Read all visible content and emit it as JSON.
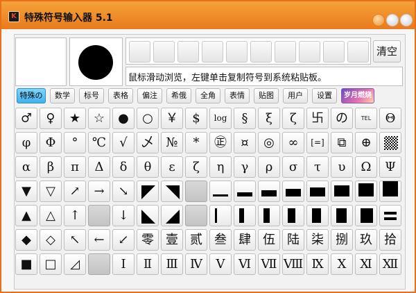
{
  "window": {
    "title": "特殊符号输入器 5.1",
    "icon": "app-logo-icon",
    "accent": "#e97b1d"
  },
  "preview": {
    "selected_symbol": "●"
  },
  "recent_slots": 10,
  "clear_label": "清空",
  "hint": "鼠标滑动浏览，左键单击复制符号到系统粘贴板。",
  "tabs": [
    {
      "label": "特殊の",
      "active": true
    },
    {
      "label": "数学"
    },
    {
      "label": "标号"
    },
    {
      "label": "表格"
    },
    {
      "label": "偏注"
    },
    {
      "label": "希俄"
    },
    {
      "label": "全角"
    },
    {
      "label": "表情"
    },
    {
      "label": "贴图"
    },
    {
      "label": "用户"
    },
    {
      "label": "设置"
    },
    {
      "label": "岁月燃烧",
      "skin": true
    }
  ],
  "grid": [
    [
      "♂",
      "♀",
      "★",
      "☆",
      "●",
      "○",
      "￥",
      "$",
      "log",
      "§",
      "ξ",
      "ζ",
      "卐",
      "の",
      "TEL",
      "Θ"
    ],
    [
      "φ",
      "Φ",
      "°",
      "℃",
      "√",
      "乄",
      "№",
      "*",
      "㊣",
      "¤",
      "◎",
      "∞",
      "[=]",
      "⧉",
      "⊕",
      "▦"
    ],
    [
      "α",
      "β",
      "π",
      "Δ",
      "δ",
      "θ",
      "ε",
      "ζ",
      "η",
      "γ",
      "ρ",
      "σ",
      "τ",
      "υ",
      "Ω",
      "Ψ"
    ],
    [
      "▼",
      "▽",
      "↗",
      "→",
      "↘",
      "◤",
      "◥",
      "",
      "▁",
      "▂",
      "▃",
      "▄",
      "▅",
      "▆",
      "▇",
      "█"
    ],
    [
      "▲",
      "△",
      "↑",
      "",
      "↓",
      "◣",
      "◢",
      "",
      "▏",
      "▍",
      "▌",
      "▋",
      "▊",
      "▉",
      "█",
      "〓"
    ],
    [
      "◆",
      "◇",
      "↖",
      "←",
      "↙",
      "零",
      "壹",
      "贰",
      "叁",
      "肆",
      "伍",
      "陆",
      "柒",
      "捌",
      "玖",
      "拾"
    ],
    [
      "■",
      "□",
      "◿",
      "",
      "Ⅰ",
      "Ⅱ",
      "Ⅲ",
      "Ⅳ",
      "Ⅴ",
      "Ⅵ",
      "Ⅶ",
      "Ⅷ",
      "Ⅸ",
      "Ⅹ",
      "Ⅺ",
      "Ⅻ"
    ]
  ]
}
